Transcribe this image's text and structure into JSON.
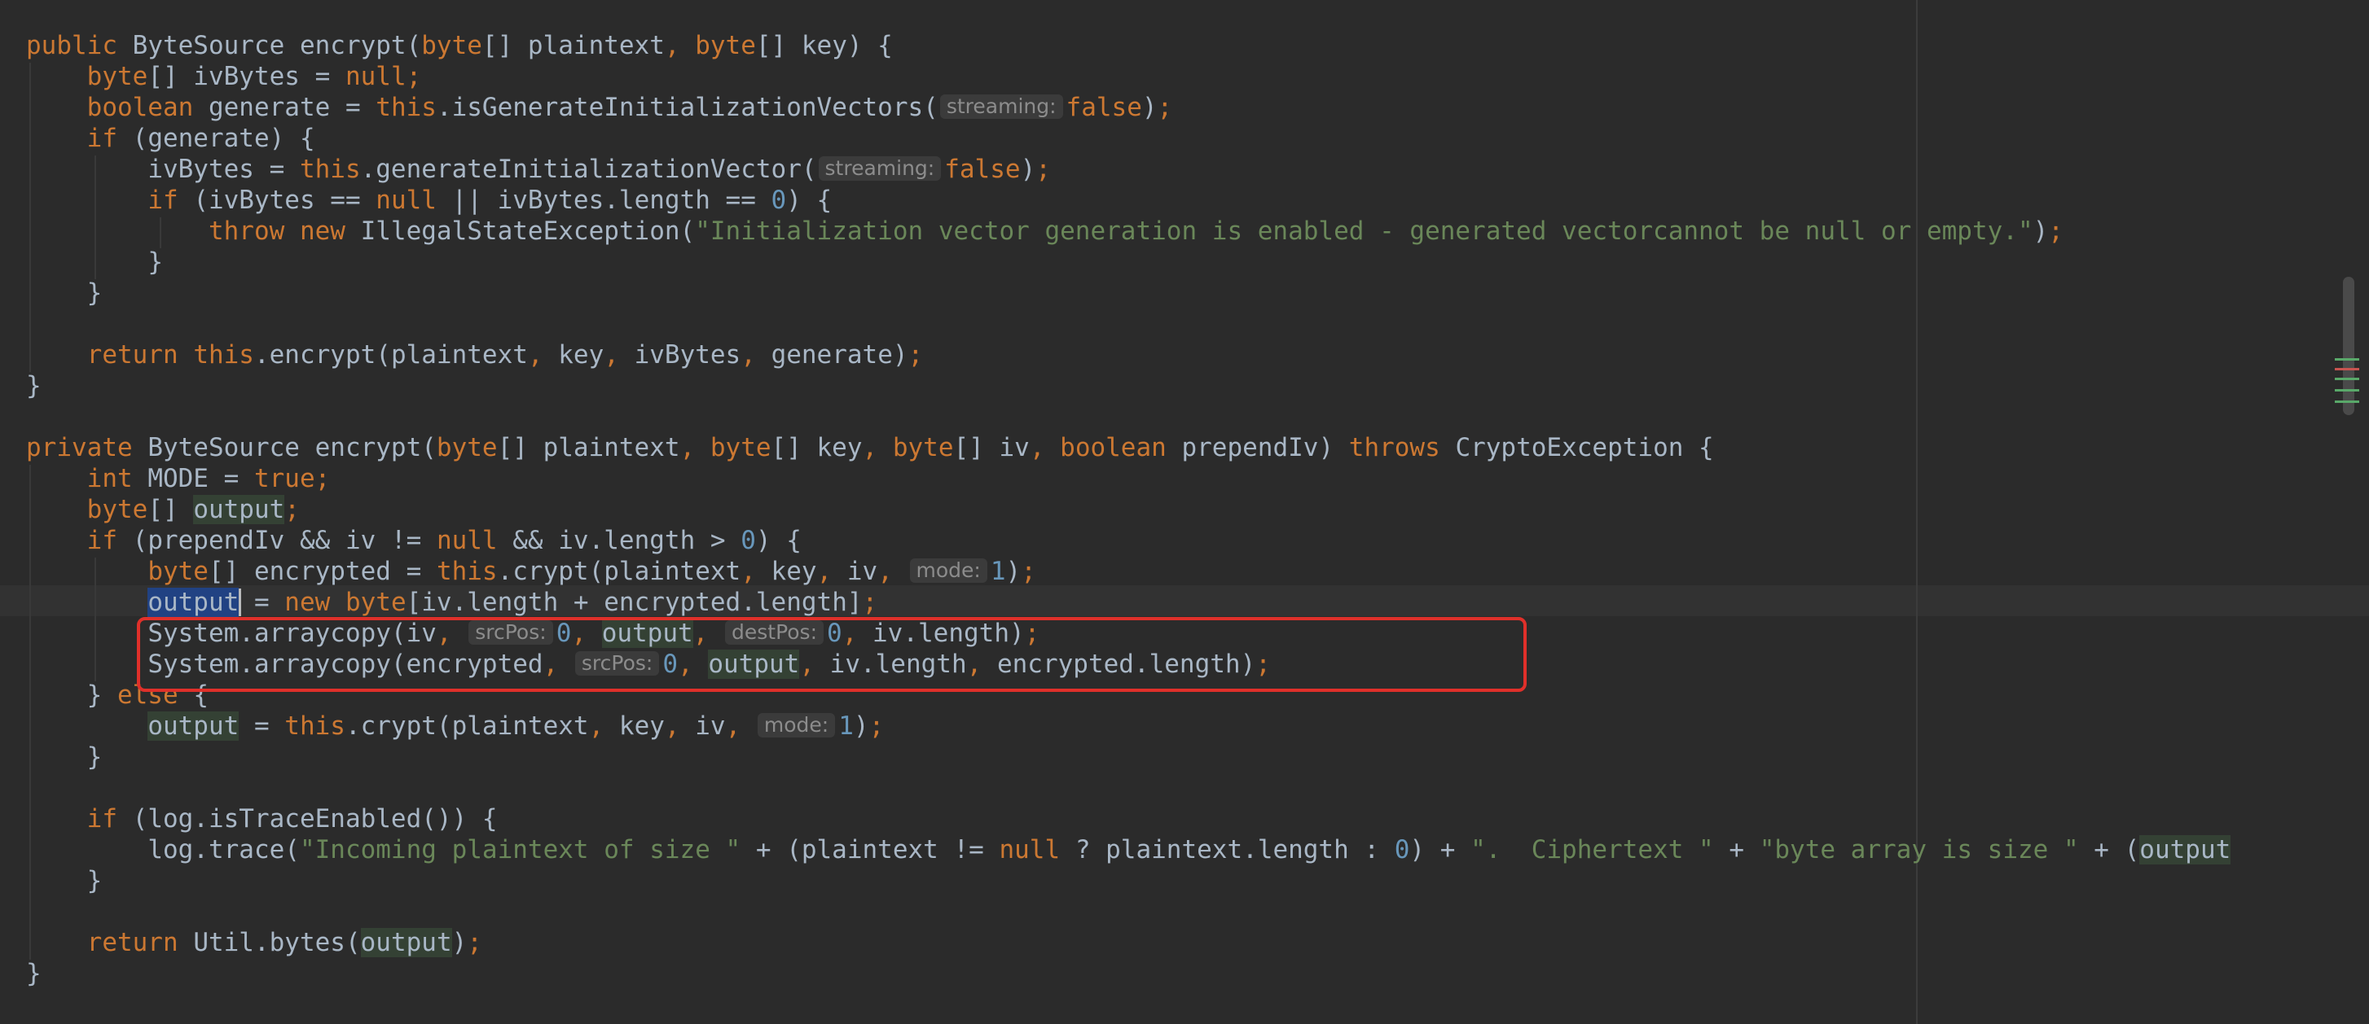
{
  "editor": {
    "lines": [
      {
        "indent": 0,
        "tokens": [
          {
            "t": "public ",
            "c": "kw"
          },
          {
            "t": "ByteSource encrypt("
          },
          {
            "t": "byte",
            "c": "kw"
          },
          {
            "t": "[] plaintext"
          },
          {
            "t": ", ",
            "c": "kw"
          },
          {
            "t": "byte",
            "c": "kw"
          },
          {
            "t": "[] key) {"
          }
        ]
      },
      {
        "indent": 1,
        "tokens": [
          {
            "t": "byte",
            "c": "kw"
          },
          {
            "t": "[] ivBytes = "
          },
          {
            "t": "null",
            "c": "kw"
          },
          {
            "t": ";",
            "c": "kw"
          }
        ]
      },
      {
        "indent": 1,
        "tokens": [
          {
            "t": "boolean ",
            "c": "kw"
          },
          {
            "t": "generate = "
          },
          {
            "t": "this",
            "c": "kw"
          },
          {
            "t": ".isGenerateInitializationVectors("
          },
          {
            "t": "streaming:",
            "c": "hint"
          },
          {
            "t": "false",
            "c": "kw"
          },
          {
            "t": ")"
          },
          {
            "t": ";",
            "c": "kw"
          }
        ]
      },
      {
        "indent": 1,
        "tokens": [
          {
            "t": "if ",
            "c": "kw"
          },
          {
            "t": "(generate) {"
          }
        ]
      },
      {
        "indent": 2,
        "tokens": [
          {
            "t": "ivBytes = "
          },
          {
            "t": "this",
            "c": "kw"
          },
          {
            "t": ".generateInitializationVector("
          },
          {
            "t": "streaming:",
            "c": "hint"
          },
          {
            "t": "false",
            "c": "kw"
          },
          {
            "t": ")"
          },
          {
            "t": ";",
            "c": "kw"
          }
        ]
      },
      {
        "indent": 2,
        "tokens": [
          {
            "t": "if ",
            "c": "kw"
          },
          {
            "t": "(ivBytes == "
          },
          {
            "t": "null ",
            "c": "kw"
          },
          {
            "t": "|| ivBytes.length == "
          },
          {
            "t": "0",
            "c": "num"
          },
          {
            "t": ") {"
          }
        ]
      },
      {
        "indent": 3,
        "tokens": [
          {
            "t": "throw new ",
            "c": "kw"
          },
          {
            "t": "IllegalStateException("
          },
          {
            "t": "\"Initialization vector generation is enabled - generated vectorcannot be null or empty.\"",
            "c": "str"
          },
          {
            "t": ")"
          },
          {
            "t": ";",
            "c": "kw"
          }
        ]
      },
      {
        "indent": 2,
        "tokens": [
          {
            "t": "}"
          }
        ]
      },
      {
        "indent": 1,
        "tokens": [
          {
            "t": "}"
          }
        ]
      },
      {
        "indent": 0,
        "tokens": []
      },
      {
        "indent": 1,
        "tokens": [
          {
            "t": "return ",
            "c": "kw"
          },
          {
            "t": "this",
            "c": "kw"
          },
          {
            "t": ".encrypt(plaintext"
          },
          {
            "t": ", ",
            "c": "kw"
          },
          {
            "t": "key"
          },
          {
            "t": ", ",
            "c": "kw"
          },
          {
            "t": "ivBytes"
          },
          {
            "t": ", ",
            "c": "kw"
          },
          {
            "t": "generate)"
          },
          {
            "t": ";",
            "c": "kw"
          }
        ]
      },
      {
        "indent": 0,
        "tokens": [
          {
            "t": "}"
          }
        ]
      },
      {
        "indent": 0,
        "tokens": []
      },
      {
        "indent": 0,
        "tokens": [
          {
            "t": "private ",
            "c": "kw"
          },
          {
            "t": "ByteSource encrypt("
          },
          {
            "t": "byte",
            "c": "kw"
          },
          {
            "t": "[] plaintext"
          },
          {
            "t": ", ",
            "c": "kw"
          },
          {
            "t": "byte",
            "c": "kw"
          },
          {
            "t": "[] key"
          },
          {
            "t": ", ",
            "c": "kw"
          },
          {
            "t": "byte",
            "c": "kw"
          },
          {
            "t": "[] iv"
          },
          {
            "t": ", ",
            "c": "kw"
          },
          {
            "t": "boolean ",
            "c": "kw"
          },
          {
            "t": "prependIv) "
          },
          {
            "t": "throws ",
            "c": "kw"
          },
          {
            "t": "CryptoException {"
          }
        ]
      },
      {
        "indent": 1,
        "tokens": [
          {
            "t": "int ",
            "c": "kw"
          },
          {
            "t": "MODE = "
          },
          {
            "t": "true",
            "c": "kw"
          },
          {
            "t": ";",
            "c": "kw"
          }
        ]
      },
      {
        "indent": 1,
        "tokens": [
          {
            "t": "byte",
            "c": "kw"
          },
          {
            "t": "[] "
          },
          {
            "t": "output",
            "c": "usage"
          },
          {
            "t": ";",
            "c": "kw"
          }
        ]
      },
      {
        "indent": 1,
        "tokens": [
          {
            "t": "if ",
            "c": "kw"
          },
          {
            "t": "(prependIv && iv != "
          },
          {
            "t": "null ",
            "c": "kw"
          },
          {
            "t": "&& iv.length > "
          },
          {
            "t": "0",
            "c": "num"
          },
          {
            "t": ") {"
          }
        ]
      },
      {
        "indent": 2,
        "tokens": [
          {
            "t": "byte",
            "c": "kw"
          },
          {
            "t": "[] encrypted = "
          },
          {
            "t": "this",
            "c": "kw"
          },
          {
            "t": ".crypt(plaintext"
          },
          {
            "t": ", ",
            "c": "kw"
          },
          {
            "t": "key"
          },
          {
            "t": ", ",
            "c": "kw"
          },
          {
            "t": "iv"
          },
          {
            "t": ", ",
            "c": "kw"
          },
          {
            "t": "mode:",
            "c": "hint"
          },
          {
            "t": "1",
            "c": "num"
          },
          {
            "t": ")"
          },
          {
            "t": ";",
            "c": "kw"
          }
        ]
      },
      {
        "indent": 2,
        "tokens": [
          {
            "t": "output",
            "c": "sel"
          },
          {
            "t": "",
            "c": "caret"
          },
          {
            "t": " = "
          },
          {
            "t": "new ",
            "c": "kw"
          },
          {
            "t": "byte",
            "c": "kw"
          },
          {
            "t": "[iv.length + encrypted.length]"
          },
          {
            "t": ";",
            "c": "kw"
          }
        ]
      },
      {
        "indent": 2,
        "tokens": [
          {
            "t": "System.arraycopy(iv"
          },
          {
            "t": ", ",
            "c": "kw"
          },
          {
            "t": "srcPos:",
            "c": "hint"
          },
          {
            "t": "0",
            "c": "num"
          },
          {
            "t": ", ",
            "c": "kw"
          },
          {
            "t": "output",
            "c": "usage"
          },
          {
            "t": ", ",
            "c": "kw"
          },
          {
            "t": "destPos:",
            "c": "hint"
          },
          {
            "t": "0",
            "c": "num"
          },
          {
            "t": ", ",
            "c": "kw"
          },
          {
            "t": "iv.length)"
          },
          {
            "t": ";",
            "c": "kw"
          }
        ]
      },
      {
        "indent": 2,
        "tokens": [
          {
            "t": "System.arraycopy(encrypted"
          },
          {
            "t": ", ",
            "c": "kw"
          },
          {
            "t": "srcPos:",
            "c": "hint"
          },
          {
            "t": "0",
            "c": "num"
          },
          {
            "t": ", ",
            "c": "kw"
          },
          {
            "t": "output",
            "c": "usage"
          },
          {
            "t": ", ",
            "c": "kw"
          },
          {
            "t": "iv.length"
          },
          {
            "t": ", ",
            "c": "kw"
          },
          {
            "t": "encrypted.length)"
          },
          {
            "t": ";",
            "c": "kw"
          }
        ]
      },
      {
        "indent": 1,
        "tokens": [
          {
            "t": "} "
          },
          {
            "t": "else ",
            "c": "kw"
          },
          {
            "t": "{"
          }
        ]
      },
      {
        "indent": 2,
        "tokens": [
          {
            "t": "output",
            "c": "usage"
          },
          {
            "t": " = "
          },
          {
            "t": "this",
            "c": "kw"
          },
          {
            "t": ".crypt(plaintext"
          },
          {
            "t": ", ",
            "c": "kw"
          },
          {
            "t": "key"
          },
          {
            "t": ", ",
            "c": "kw"
          },
          {
            "t": "iv"
          },
          {
            "t": ", ",
            "c": "kw"
          },
          {
            "t": "mode:",
            "c": "hint"
          },
          {
            "t": "1",
            "c": "num"
          },
          {
            "t": ")"
          },
          {
            "t": ";",
            "c": "kw"
          }
        ]
      },
      {
        "indent": 1,
        "tokens": [
          {
            "t": "}"
          }
        ]
      },
      {
        "indent": 0,
        "tokens": []
      },
      {
        "indent": 1,
        "tokens": [
          {
            "t": "if ",
            "c": "kw"
          },
          {
            "t": "(log.isTraceEnabled()) {"
          }
        ]
      },
      {
        "indent": 2,
        "tokens": [
          {
            "t": "log.trace("
          },
          {
            "t": "\"Incoming plaintext of size \"",
            "c": "str"
          },
          {
            "t": " + (plaintext != "
          },
          {
            "t": "null ",
            "c": "kw"
          },
          {
            "t": "? plaintext.length : "
          },
          {
            "t": "0",
            "c": "num"
          },
          {
            "t": ") + "
          },
          {
            "t": "\".  Ciphertext \"",
            "c": "str"
          },
          {
            "t": " + "
          },
          {
            "t": "\"byte array is size \"",
            "c": "str"
          },
          {
            "t": " + ("
          },
          {
            "t": "output",
            "c": "usage"
          }
        ]
      },
      {
        "indent": 1,
        "tokens": [
          {
            "t": "}"
          }
        ]
      },
      {
        "indent": 0,
        "tokens": []
      },
      {
        "indent": 1,
        "tokens": [
          {
            "t": "return ",
            "c": "kw"
          },
          {
            "t": "Util.bytes("
          },
          {
            "t": "output",
            "c": "usage"
          },
          {
            "t": ")"
          },
          {
            "t": ";",
            "c": "kw"
          }
        ]
      },
      {
        "indent": 0,
        "tokens": [
          {
            "t": "}"
          }
        ]
      }
    ]
  },
  "colors": {
    "background": "#2b2b2b",
    "keyword": "#cc7832",
    "string": "#6a8759",
    "number": "#6897bb",
    "default_text": "#a9b7c6",
    "annotation_box": "#e0302a"
  }
}
